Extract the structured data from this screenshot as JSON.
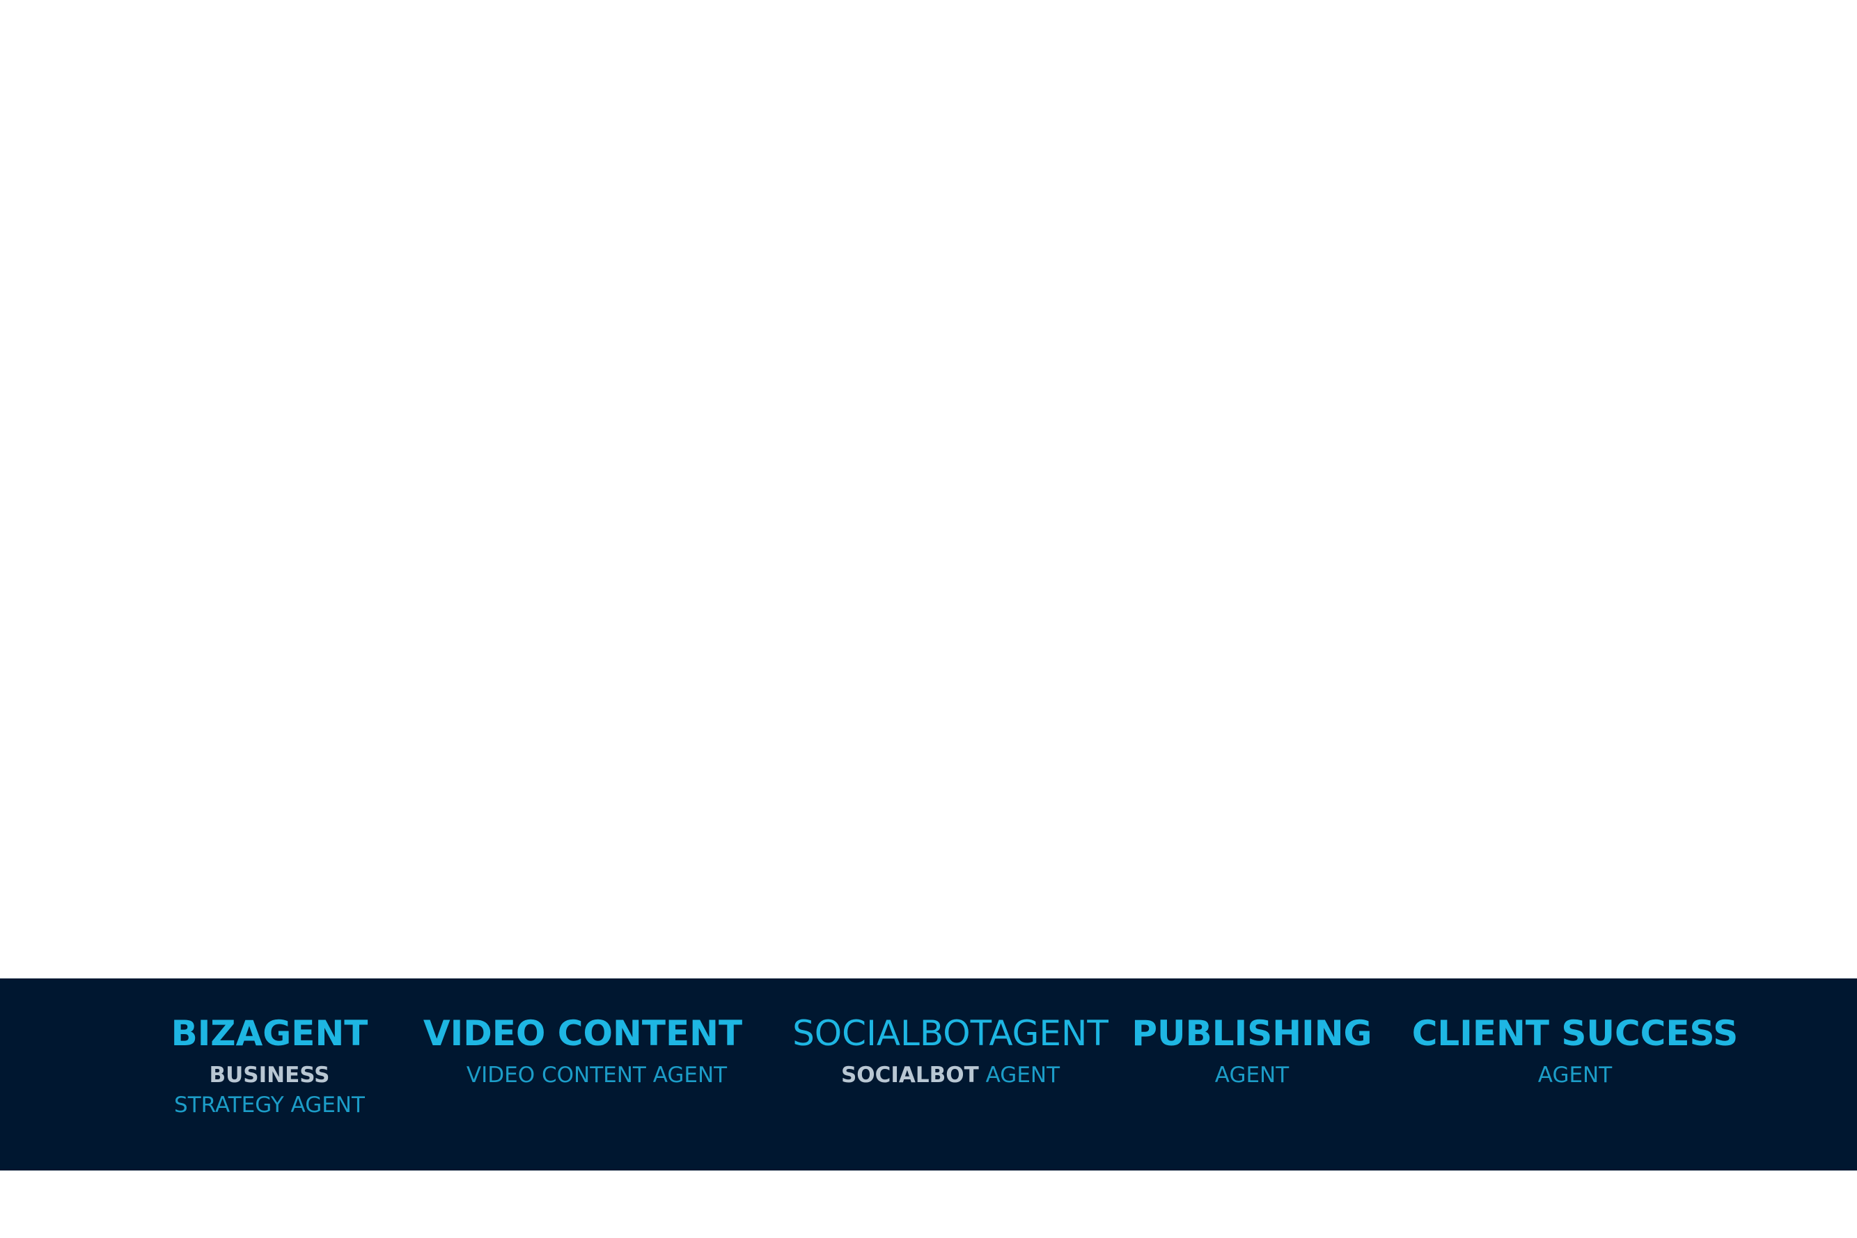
{
  "colors": {
    "background": "#ffffff",
    "band": "#001730",
    "title": "#1eb6e3",
    "subtitle": "#1c9dc8",
    "highlight": "#b9c7d3"
  },
  "agents": [
    {
      "title": "BIZAGENT",
      "sub_highlight": "BUSINESS",
      "sub_rest": "STRATEGY AGENT"
    },
    {
      "title": "VIDEO CONTENT",
      "sub_highlight": "",
      "sub_rest": "VIDEO CONTENT AGENT"
    },
    {
      "title": "SOCIALBOTAGENT",
      "sub_highlight": "SOCIALBOT",
      "sub_rest": "AGENT"
    },
    {
      "title": "PUBLISHING",
      "sub_highlight": "",
      "sub_rest": "AGENT"
    },
    {
      "title": "CLIENT SUCCESS",
      "sub_highlight": "",
      "sub_rest": "AGENT"
    }
  ]
}
